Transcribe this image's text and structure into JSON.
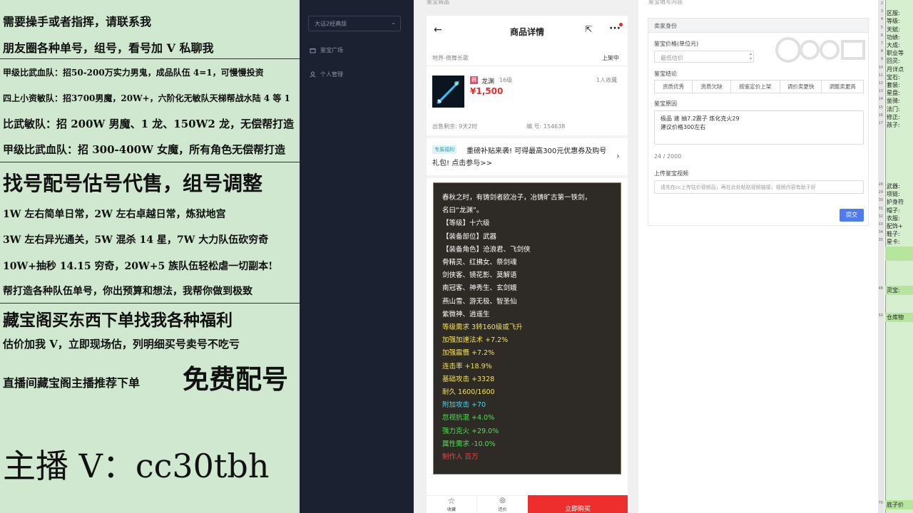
{
  "promo": {
    "lines": [
      "需要操手或者指挥，请联系我",
      "朋友圈各种单号，组号，看号加 V 私聊我",
      "甲级比武血队：招50-200万实力男鬼，成品队伍 4=1，可慢慢投资",
      "四上小资敏队：招3700男魔，20W+，六阶化无敏队天梯帮战水陆 4 等 1",
      "比武敏队：招 200W 男魔、1 龙、150W2 龙，无偿帮打造",
      "甲级比武血队：招 300-400W 女魔，所有角色无偿帮打造",
      "找号配号估号代售，组号调整",
      "1W 左右简单日常，2W 左右卓越日常，炼狱地宫",
      "3W 左右异光通关，5W 混杀 14 星，7W 大力队伍砍穷奇",
      "10W+抽秒 14.15 穷奇，20W+5 族队伍轻松虐一切副本!",
      "帮打造各种队伍单号，你出预算和想法，我帮你做到极致",
      "藏宝阁买东西下单找我各种福利",
      "估价加我 V，立即现场估，列明细买号卖号不吃亏",
      "直播间藏宝阁主播推荐下单",
      "免费配号",
      "主播 V：cc30tbh"
    ]
  },
  "sidebar": {
    "select_value": "大话2经典版",
    "items": [
      {
        "label": "鉴宝广场",
        "icon": "gift-box-icon"
      },
      {
        "label": "个人管理",
        "icon": "user-icon"
      }
    ]
  },
  "phone": {
    "section_label": "鉴宝商品",
    "nav_title": "商品详情",
    "server": "地界-倚舞长歌",
    "status": "上架中",
    "item_tag": "器",
    "item_name": "龙渊",
    "item_level": "16级",
    "favorites": "1人收藏",
    "price": "¥1,500",
    "time_left": "出售剩余: 9天2时",
    "serial": "编 号: 154638",
    "promo_tag": "专属福利",
    "promo_text": "重磅补贴来袭! 可得最高300元优惠券及购号礼包! 点击参与>>",
    "description": [
      {
        "text": "春秋之时，有铸剑者欧冶子，冶铸旷古第一铁剑，",
        "color": "#ffffff"
      },
      {
        "text": "名曰“龙渊”。",
        "color": "#ffffff"
      },
      {
        "text": "【等级】十六级",
        "color": "#ffffff"
      },
      {
        "text": "【装备部位】武器",
        "color": "#ffffff"
      },
      {
        "text": "【装备角色】沧浪君、飞剑侠",
        "color": "#ffffff"
      },
      {
        "text": "骨精灵、红拂女、祭剑魂",
        "color": "#ffffff"
      },
      {
        "text": "剑侠客、镜花影、莫解语",
        "color": "#ffffff"
      },
      {
        "text": "南冠客、神秀生、玄剑娥",
        "color": "#ffffff"
      },
      {
        "text": "燕山雪、游无极、智圣仙",
        "color": "#ffffff"
      },
      {
        "text": "紫微神、逍遥生",
        "color": "#ffffff"
      },
      {
        "text": "等级需求 3转160级或飞升",
        "color": "#f5e15a"
      },
      {
        "text": "加强加速法术 +7.2%",
        "color": "#f5e15a"
      },
      {
        "text": "加强震慑 +7.2%",
        "color": "#f5e15a"
      },
      {
        "text": "连击率 +18.9%",
        "color": "#f5e15a"
      },
      {
        "text": "基础攻击 +3328",
        "color": "#f5e15a"
      },
      {
        "text": "耐久 1600/1600",
        "color": "#f5e15a"
      },
      {
        "text": "附加攻击 +70",
        "color": "#4fd4f0"
      },
      {
        "text": "忽视抗混 +4.0%",
        "color": "#4fe04f"
      },
      {
        "text": "强力克火 +29.0%",
        "color": "#4fe04f"
      },
      {
        "text": "属性需求 -10.0%",
        "color": "#4fe04f"
      },
      {
        "text": "制作人 百万",
        "color": "#ff4040"
      }
    ],
    "bottom": {
      "fav_label": "收藏",
      "appraise_label": "还价",
      "buy_label": "立即购买"
    }
  },
  "form": {
    "section_label": "鉴宝填写内容",
    "card_header": "卖家身份",
    "price_label": "鉴宝价格(单位元)",
    "price_placeholder": "最低估价",
    "conclusion_label": "鉴宝结论",
    "conclusion_options": [
      "资质优秀",
      "资质欠缺",
      "按鉴定价上架",
      "调价卖更快",
      "调整卖更高"
    ],
    "reason_label": "鉴宝原因",
    "reason_lines": [
      "极品 速 抽7.2震子 炼化克火29",
      "建议价格300左右"
    ],
    "char_count": "24 / 2000",
    "video_label": "上传鉴宝视频",
    "video_placeholder": "请先在cc上传估价视频后，再在此处粘贴视频链接；视频内容有助于好",
    "submit_label": "提交"
  },
  "sheet": {
    "rows": [
      {
        "n": "2",
        "t": ""
      },
      {
        "n": "3",
        "t": "区服:"
      },
      {
        "n": "4",
        "t": "等级:"
      },
      {
        "n": "5",
        "t": "天赋:"
      },
      {
        "n": "6",
        "t": "功绩:"
      },
      {
        "n": "7",
        "t": "大成:"
      },
      {
        "n": "8",
        "t": "职业等"
      },
      {
        "n": "9",
        "t": "回灵:"
      },
      {
        "n": "10",
        "t": "月详点"
      },
      {
        "n": "11",
        "t": "宝石:"
      },
      {
        "n": "12",
        "t": "套装:"
      },
      {
        "n": "13",
        "t": "星盘:"
      },
      {
        "n": "14",
        "t": "坐骑:"
      },
      {
        "n": "15",
        "t": "法门:"
      },
      {
        "n": "16",
        "t": "修正:"
      },
      {
        "n": "17",
        "t": "孩子:"
      },
      {
        "n": "",
        "t": ""
      },
      {
        "n": "",
        "t": ""
      },
      {
        "n": "",
        "t": ""
      },
      {
        "n": "",
        "t": ""
      },
      {
        "n": "28",
        "t": "武器:"
      },
      {
        "n": "29",
        "t": "项链:"
      },
      {
        "n": "30",
        "t": "护身符"
      },
      {
        "n": "31",
        "t": "帽子:"
      },
      {
        "n": "32",
        "t": "衣服:"
      },
      {
        "n": "33",
        "t": "配饰+"
      },
      {
        "n": "34",
        "t": "鞋子:"
      },
      {
        "n": "35",
        "t": "星卡:"
      }
    ],
    "lower": [
      {
        "n": "48",
        "t": "灵宝:"
      },
      {
        "n": "50",
        "t": "仓库物"
      },
      {
        "n": "70",
        "t": "底子价"
      }
    ]
  }
}
